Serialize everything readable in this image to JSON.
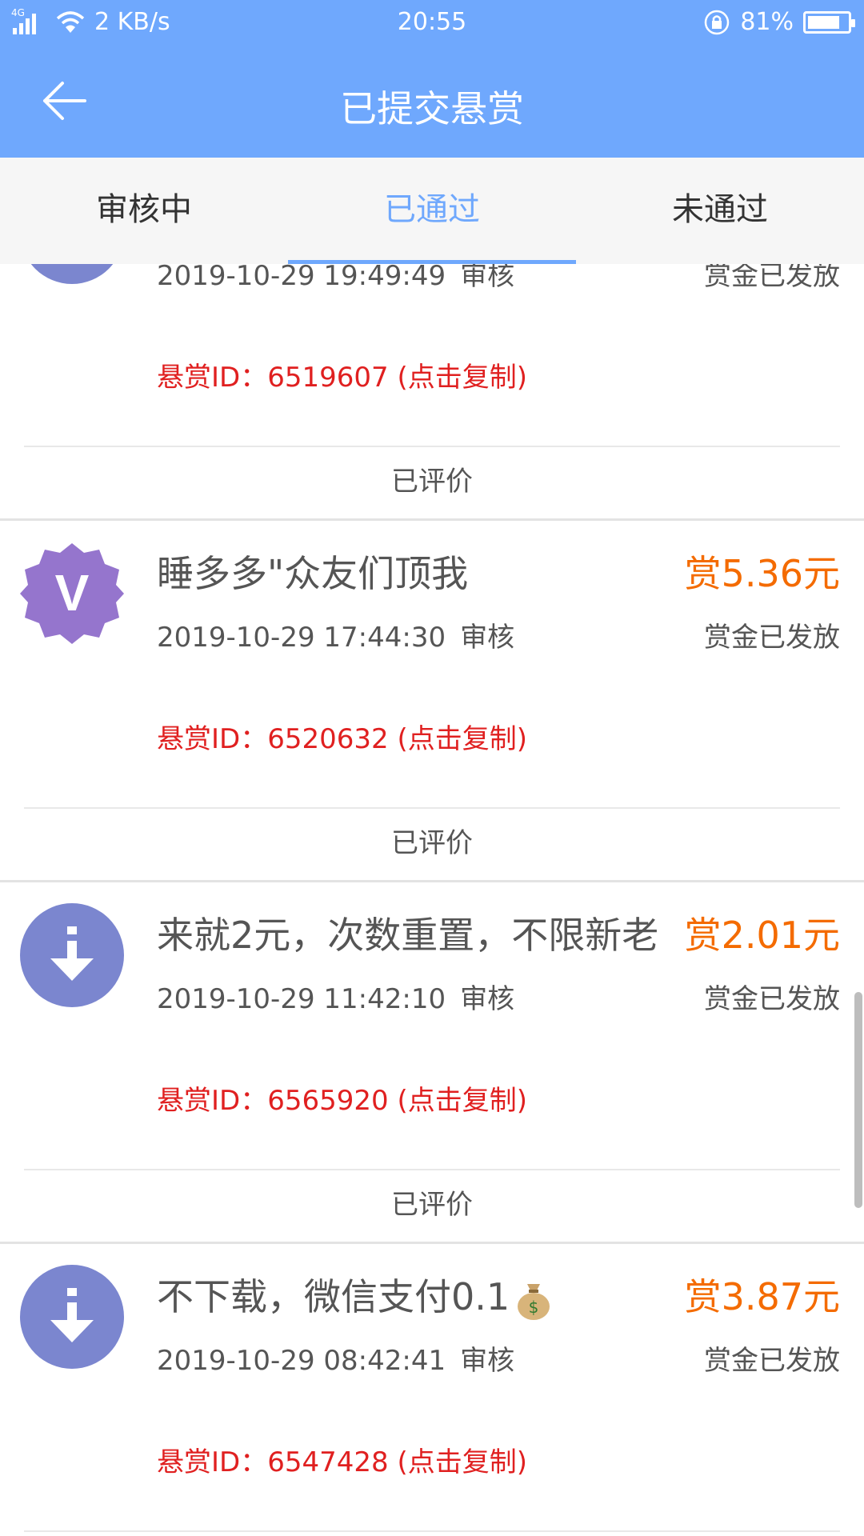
{
  "statusbar": {
    "network": "4G",
    "speed": "2 KB/s",
    "time": "20:55",
    "battery": "81%",
    "battery_level": 0.81
  },
  "header": {
    "title": "已提交悬赏"
  },
  "tabs": [
    {
      "label": "审核中",
      "active": false
    },
    {
      "label": "已通过",
      "active": true
    },
    {
      "label": "未通过",
      "active": false
    }
  ],
  "items": [
    {
      "title": "",
      "reward": "",
      "time": "2019-10-29 19:49:49",
      "review": "审核",
      "status": "赏金已发放",
      "id_line": "悬赏ID：6519607 (点击复制)",
      "rated": "已评价",
      "avatar": "download-icon"
    },
    {
      "title": "睡多多\"众友们顶我",
      "reward": "赏5.36元",
      "time": "2019-10-29 17:44:30",
      "review": "审核",
      "status": "赏金已发放",
      "id_line": "悬赏ID：6520632 (点击复制)",
      "rated": "已评价",
      "avatar": "vip-badge-icon",
      "avatar_letter": "V"
    },
    {
      "title": "来就2元，次数重置，不限新老",
      "reward": "赏2.01元",
      "time": "2019-10-29 11:42:10",
      "review": "审核",
      "status": "赏金已发放",
      "id_line": "悬赏ID：6565920 (点击复制)",
      "rated": "已评价",
      "avatar": "download-icon"
    },
    {
      "title": "不下载，微信支付0.1",
      "reward": "赏3.87元",
      "time": "2019-10-29 08:42:41",
      "review": "审核",
      "status": "赏金已发放",
      "id_line": "悬赏ID：6547428 (点击复制)",
      "rated": "",
      "avatar": "download-icon"
    }
  ],
  "colors": {
    "primary": "#6fa8fd",
    "reward": "#f46b00",
    "id_red": "#e02020",
    "avatar": "#7b86cf",
    "vip": "#9575cd"
  }
}
